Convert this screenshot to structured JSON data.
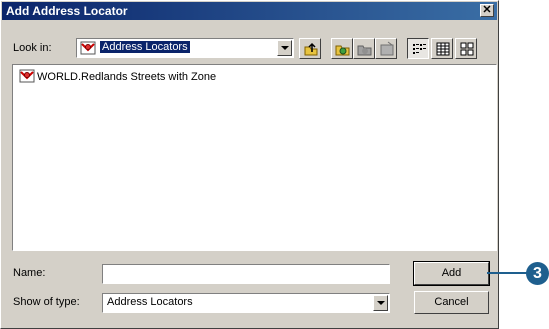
{
  "window": {
    "title": "Add Address Locator",
    "close_glyph": "✕"
  },
  "look_in": {
    "label": "Look in:",
    "value": "Address Locators",
    "icon": "address-locator-icon"
  },
  "toolbar": {
    "buttons": [
      {
        "name": "up-one-level-icon"
      },
      {
        "name": "connect-folder-icon"
      },
      {
        "name": "disconnect-folder-icon"
      },
      {
        "name": "new-icon"
      },
      {
        "name": "list-view-icon"
      },
      {
        "name": "details-view-icon"
      },
      {
        "name": "thumbnails-view-icon"
      }
    ]
  },
  "list": {
    "items": [
      {
        "label": "WORLD.Redlands Streets with Zone",
        "icon": "address-locator-icon"
      }
    ]
  },
  "name_field": {
    "label": "Name:",
    "value": ""
  },
  "type_field": {
    "label": "Show of type:",
    "value": "Address Locators"
  },
  "buttons": {
    "add": "Add",
    "cancel": "Cancel"
  },
  "callout": {
    "number": "3",
    "color": "#1e5f8e"
  },
  "colors": {
    "title_start": "#0a246a",
    "title_end": "#3a6ea5",
    "face": "#d4d0c8",
    "selection": "#0a246a"
  }
}
